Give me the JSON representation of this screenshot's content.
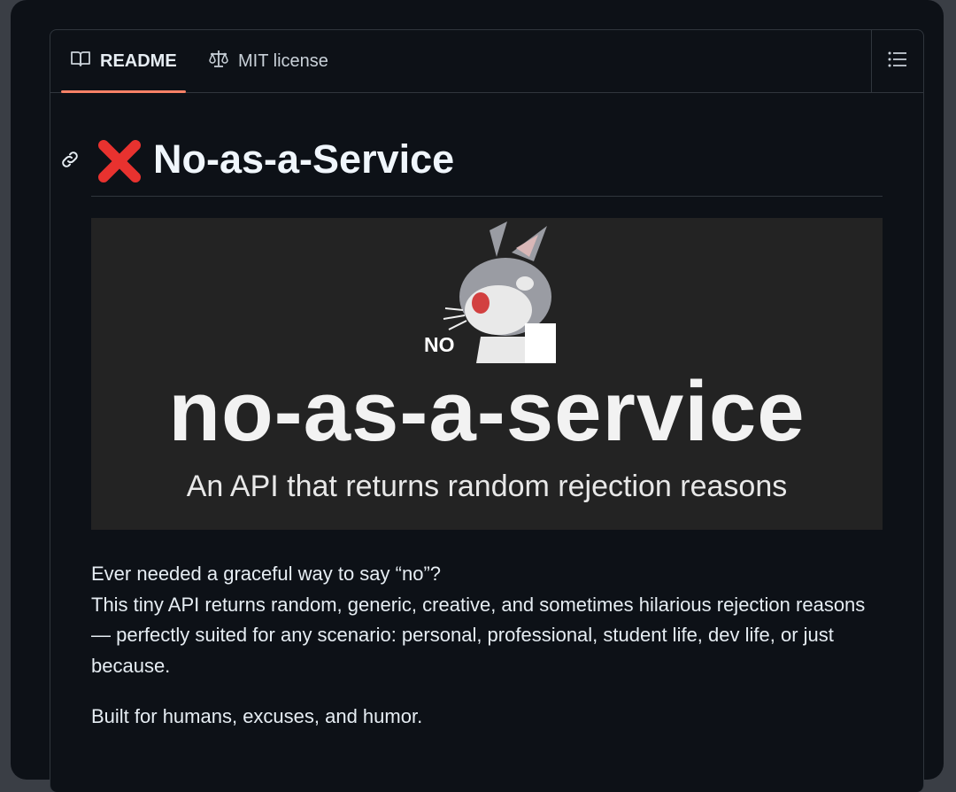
{
  "tabs": [
    {
      "label": "README",
      "icon": "book-icon",
      "active": true
    },
    {
      "label": "MIT license",
      "icon": "scale-icon",
      "active": false
    }
  ],
  "toc_icon": "list-icon",
  "readme": {
    "heading": {
      "emoji": "❌",
      "text": "No-as-a-Service",
      "anchor_icon": "link-icon"
    },
    "banner": {
      "badge_text": "NO",
      "title": "no-as-a-service",
      "subtitle": "An API that returns random rejection reasons",
      "image": "bugs-bunny-no-meme"
    },
    "paragraphs": [
      {
        "line1": "Ever needed a graceful way to say “no”?",
        "line2": "This tiny API returns random, generic, creative, and sometimes hilarious rejection reasons — perfectly suited for any scenario: personal, professional, student life, dev life, or just because."
      },
      {
        "line1": "Built for humans, excuses, and humor."
      }
    ]
  },
  "colors": {
    "background": "#0d1117",
    "border": "#30363d",
    "active_tab_underline": "#f78166",
    "text": "#e6edf3",
    "banner_bg": "#232323"
  }
}
